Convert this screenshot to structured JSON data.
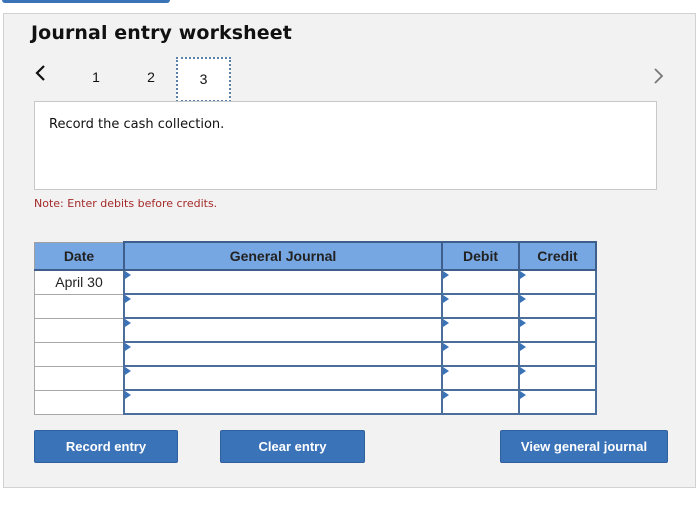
{
  "worksheet": {
    "title": "Journal entry worksheet",
    "tabs": [
      {
        "label": "1",
        "active": false
      },
      {
        "label": "2",
        "active": false
      },
      {
        "label": "3",
        "active": true
      }
    ],
    "instruction": "Record the cash collection.",
    "note": "Note: Enter debits before credits."
  },
  "table": {
    "headers": {
      "date": "Date",
      "account": "General Journal",
      "debit": "Debit",
      "credit": "Credit"
    },
    "rows": [
      {
        "date": "April 30",
        "account": "",
        "debit": "",
        "credit": ""
      },
      {
        "date": "",
        "account": "",
        "debit": "",
        "credit": ""
      },
      {
        "date": "",
        "account": "",
        "debit": "",
        "credit": ""
      },
      {
        "date": "",
        "account": "",
        "debit": "",
        "credit": ""
      },
      {
        "date": "",
        "account": "",
        "debit": "",
        "credit": ""
      },
      {
        "date": "",
        "account": "",
        "debit": "",
        "credit": ""
      }
    ]
  },
  "buttons": {
    "record": "Record entry",
    "clear": "Clear entry",
    "view": "View general journal"
  },
  "colors": {
    "accent": "#3b73b9",
    "header_bg": "#76a7e2",
    "note": "#a52a2a"
  }
}
